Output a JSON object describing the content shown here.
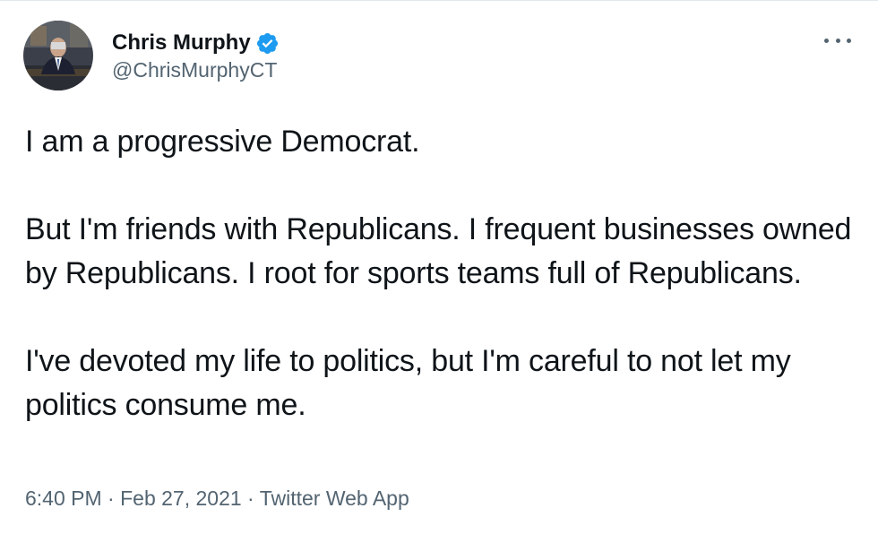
{
  "author": {
    "display_name": "Chris Murphy",
    "handle": "@ChrisMurphyCT",
    "verified": true,
    "avatar_icon": "profile-photo"
  },
  "menu": {
    "icon": "more-options-icon"
  },
  "tweet": {
    "paragraphs": [
      "I am a progressive Democrat.",
      "But I'm friends with Republicans. I frequent businesses owned by Republicans. I root for sports teams full of Republicans.",
      "I've devoted my life to politics, but I'm careful to not let my politics consume me."
    ]
  },
  "meta": {
    "time": "6:40 PM",
    "separator": " · ",
    "date": "Feb 27, 2021",
    "source": "Twitter Web App"
  },
  "colors": {
    "text": "#0f1419",
    "secondary": "#536471",
    "verified_blue": "#1d9bf0"
  }
}
